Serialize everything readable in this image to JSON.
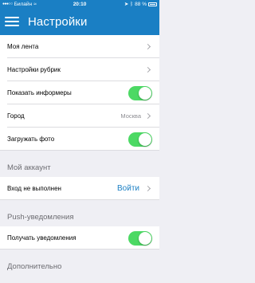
{
  "status_bar": {
    "carrier": "Билайн",
    "time": "20:10",
    "battery": "88 %"
  },
  "nav": {
    "title": "Настройки",
    "menu_icon": "hamburger-menu-icon"
  },
  "colors": {
    "accent": "#1a7fc4",
    "toggle_on": "#4cd964",
    "background": "#efeff4"
  },
  "rows": {
    "feed": {
      "label": "Моя лента"
    },
    "rubrics": {
      "label": "Настройки рубрик"
    },
    "informers": {
      "label": "Показать информеры",
      "on": true
    },
    "city": {
      "label": "Город",
      "value": "Москва"
    },
    "photos": {
      "label": "Загружать фото",
      "on": true
    },
    "login": {
      "label": "Вход не выполнен",
      "value": "Войти"
    },
    "push": {
      "label": "Получать уведомления",
      "on": true
    }
  },
  "sections": {
    "account": "Мой аккаунт",
    "push": "Push-уведомления",
    "extra": "Дополнительно"
  }
}
